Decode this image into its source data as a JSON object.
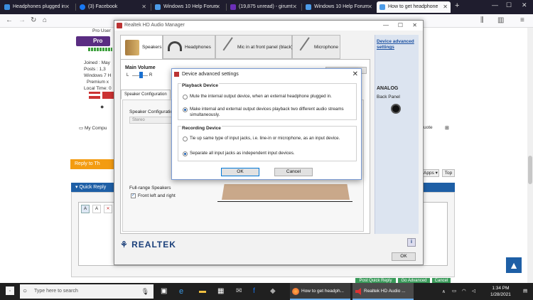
{
  "browser": {
    "tabs": [
      {
        "label": "Headphones plugged in",
        "color": "#3a8dde"
      },
      {
        "label": "(3) Facebook",
        "color": "#1877f2"
      },
      {
        "label": "Windows 10 Help Forum",
        "color": "#4c9be8"
      },
      {
        "label": "(19,875 unread) - girumt",
        "color": "#6b2fb8"
      },
      {
        "label": "Windows 10 Help Forum",
        "color": "#4c9be8"
      },
      {
        "label": "How to get headphone",
        "color": "#4c9be8"
      }
    ],
    "toolbar_icons": [
      "back-icon",
      "forward-icon",
      "reload-icon",
      "home-icon",
      "library-icon",
      "sidebar-icon",
      "menu-icon"
    ]
  },
  "forum": {
    "user_title": "Pro User",
    "user_rank_badge": "Pro Us",
    "joined": "Joined : May",
    "posts": "Posts : 1,3",
    "os": "Windows 7 H",
    "os2": "Premium x",
    "local_time": "Local Time: 0",
    "my_computer": "My Compu",
    "quote": "uote",
    "reply_to": "Reply to Th",
    "apps": "Apps",
    "top": "Top",
    "quick_reply": "Quick Reply",
    "post_quick_reply": "Post Quick Reply",
    "go_advanced": "Go Advanced",
    "cancel": "Cancel"
  },
  "realtek": {
    "title": "Realtek HD Audio Manager",
    "tabs": [
      "Speakers",
      "Headphones",
      "Mic in at front panel (black)",
      "Microphone"
    ],
    "main_volume": "Main Volume",
    "vol_l": "L",
    "vol_r": "R",
    "speaker_config_tab": "Speaker Configuration",
    "speaker_config_label": "Speaker Configuration",
    "speaker_config_value": "Stereo",
    "full_range": "Full-range Speakers",
    "front_lr": "Front left and right",
    "device_adv_link": "Device advanced settings",
    "analog": "ANALOG",
    "back_panel": "Back Panel",
    "brand": "REALTEK",
    "ok": "OK",
    "info": "i"
  },
  "dialog": {
    "title": "Device advanced settings",
    "playback_group": "Playback Device",
    "playback_opt1": "Mute the internal output device, when an external headphone plugged in.",
    "playback_opt2": "Make internal and external output devices playback two different audio streams simultaneously.",
    "recording_group": "Recording Device",
    "recording_opt1": "Tie up same type of input jacks, i.e. line-in or microphone, as an input device.",
    "recording_opt2": "Separate all input jacks as independent input devices.",
    "ok": "OK",
    "cancel": "Cancel"
  },
  "taskbar": {
    "search_placeholder": "Type here to search",
    "app1": "How to get headph...",
    "app2": "Realtek HD Audio ...",
    "time": "1:34 PM",
    "date": "1/28/2021"
  }
}
